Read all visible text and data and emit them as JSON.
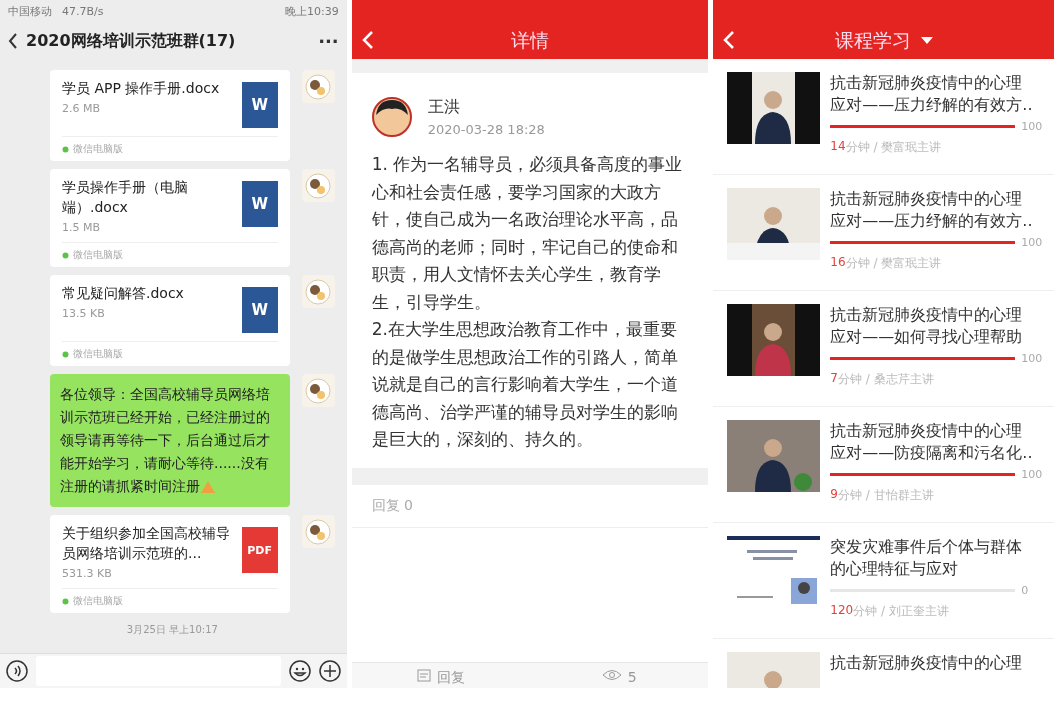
{
  "chat": {
    "status_bar": {
      "carrier": "中国移动",
      "speed": "47.7B/s",
      "time": "晚上10:39"
    },
    "title": "2020网络培训示范班群(17)",
    "more": "···",
    "messages": [
      {
        "kind": "file",
        "name": "学员 APP 操作手册.docx",
        "size": "2.6 MB",
        "source": "微信电脑版",
        "badge": "W"
      },
      {
        "kind": "file",
        "name": "学员操作手册（电脑端）.docx",
        "size": "1.5 MB",
        "source": "微信电脑版",
        "badge": "W"
      },
      {
        "kind": "file",
        "name": "常见疑问解答.docx",
        "size": "13.5 KB",
        "source": "微信电脑版",
        "badge": "W"
      },
      {
        "kind": "text",
        "text": "各位领导：全国高校辅导员网络培训示范班已经开始，已经注册过的领导请再等待一下，后台通过后才能开始学习，请耐心等待......没有注册的请抓紧时间注册"
      },
      {
        "kind": "pdf",
        "name": "关于组织参加全国高校辅导员网络培训示范班的...",
        "size": "531.3 KB",
        "source": "微信电脑版",
        "badge": "PDF"
      }
    ],
    "timestamp": "3月25日 早上10:17"
  },
  "detail": {
    "title": "详情",
    "author": "王洪",
    "date": "2020-03-28 18:28",
    "paragraphs": [
      "1. 作为一名辅导员，必须具备高度的事业心和社会责任感，要学习国家的大政方针，使自己成为一名政治理论水平高，品德高尚的老师；同时，牢记自己的使命和职责，用人文情怀去关心学生，教育学生，引导学生。",
      "2.在大学生思想政治教育工作中，最重要的是做学生思想政治工作的引路人，简单说就是自己的言行影响着大学生，一个道德高尚、治学严谨的辅导员对学生的影响是巨大的，深刻的、持久的。"
    ],
    "replies": "回复 0",
    "reply_button": "回复",
    "views": "5"
  },
  "courses": {
    "title": "课程学习",
    "items": [
      {
        "title": "抗击新冠肺炎疫情中的心理应对——压力纾解的有效方..",
        "level": 1,
        "percent": "100",
        "minutes": "14",
        "meta": "分钟 / 樊富珉主讲"
      },
      {
        "title": "抗击新冠肺炎疫情中的心理应对——压力纾解的有效方..",
        "level": 1,
        "percent": "100",
        "minutes": "16",
        "meta": "分钟 / 樊富珉主讲"
      },
      {
        "title": "抗击新冠肺炎疫情中的心理应对——如何寻找心理帮助",
        "level": 1,
        "percent": "100",
        "minutes": "7",
        "meta": "分钟 / 桑志芹主讲"
      },
      {
        "title": "抗击新冠肺炎疫情中的心理应对——防疫隔离和污名化..",
        "level": 1,
        "percent": "100",
        "minutes": "9",
        "meta": "分钟 / 甘怡群主讲"
      },
      {
        "title": "突发灾难事件后个体与群体的心理特征与应对",
        "level": 0,
        "percent": "0",
        "minutes": "120",
        "meta": "分钟 / 刘正奎主讲"
      },
      {
        "title": "抗击新冠肺炎疫情中的心理"
      }
    ]
  }
}
